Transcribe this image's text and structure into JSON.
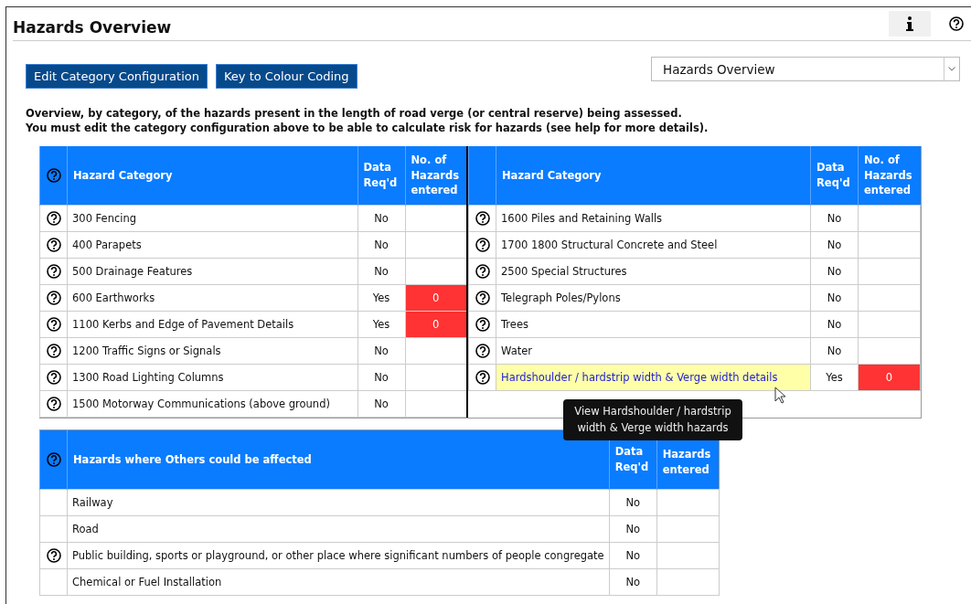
{
  "header": {
    "title": "Hazards Overview"
  },
  "buttons": [
    {
      "label": "Edit Category Configuration"
    },
    {
      "label": "Key to Colour Coding"
    }
  ],
  "view_select": {
    "value": "Hazards Overview"
  },
  "intro": [
    "Overview, by category, of the hazards present in the length of road verge (or central reserve) being assessed.",
    "You must edit the category configuration above to be able to calculate risk for hazards (see help for more details)."
  ],
  "category_tables": [
    {
      "help": true,
      "columns": [
        "Hazard Category",
        "Data Req'd",
        "No. of Hazards entered"
      ],
      "rows": [
        {
          "help": true,
          "kind": "text",
          "hovered": false,
          "category": "300 Fencing",
          "data_reqd": "No",
          "flagged": false
        },
        {
          "help": true,
          "kind": "text",
          "hovered": false,
          "category": "400 Parapets",
          "data_reqd": "No",
          "flagged": false
        },
        {
          "help": true,
          "kind": "text",
          "hovered": false,
          "category": "500 Drainage Features",
          "data_reqd": "No",
          "flagged": false
        },
        {
          "help": true,
          "kind": "text",
          "hovered": false,
          "category": "600 Earthworks",
          "data_reqd": "Yes",
          "count": "0",
          "flagged": true
        },
        {
          "help": true,
          "kind": "text",
          "hovered": false,
          "category": "1100 Kerbs and Edge of Pavement Details",
          "data_reqd": "Yes",
          "count": "0",
          "flagged": true
        },
        {
          "help": true,
          "kind": "text",
          "hovered": false,
          "category": "1200 Traffic Signs or Signals",
          "data_reqd": "No",
          "flagged": false
        },
        {
          "help": true,
          "kind": "text",
          "hovered": false,
          "category": "1300 Road Lighting Columns",
          "data_reqd": "No",
          "flagged": false
        },
        {
          "help": true,
          "kind": "text",
          "hovered": false,
          "category": "1500 Motorway Communications (above ground)",
          "data_reqd": "No",
          "flagged": false
        }
      ]
    },
    {
      "help": false,
      "columns": [
        "Hazard Category",
        "Data Req'd",
        "No. of Hazards entered"
      ],
      "rows": [
        {
          "help": true,
          "kind": "text",
          "hovered": false,
          "category": "1600 Piles and Retaining Walls",
          "data_reqd": "No",
          "flagged": false
        },
        {
          "help": true,
          "kind": "text",
          "hovered": false,
          "category": "1700 1800 Structural Concrete and Steel",
          "data_reqd": "No",
          "flagged": false
        },
        {
          "help": true,
          "kind": "text",
          "hovered": false,
          "category": "2500 Special Structures",
          "data_reqd": "No",
          "flagged": false
        },
        {
          "help": true,
          "kind": "text",
          "hovered": false,
          "category": "Telegraph Poles/Pylons",
          "data_reqd": "No",
          "flagged": false
        },
        {
          "help": true,
          "kind": "text",
          "hovered": false,
          "category": "Trees",
          "data_reqd": "No",
          "flagged": false
        },
        {
          "help": true,
          "kind": "text",
          "hovered": false,
          "category": "Water",
          "data_reqd": "No",
          "flagged": false
        },
        {
          "help": true,
          "kind": "link",
          "hovered": true,
          "category": "Hardshoulder / hardstrip width & Verge width details",
          "data_reqd": "Yes",
          "count": "0",
          "flagged": true
        }
      ]
    }
  ],
  "others_table": {
    "help": true,
    "columns": [
      "Hazards where Others could be affected",
      "Data Req'd",
      "Hazards entered"
    ],
    "rows": [
      {
        "help": false,
        "category": "Railway",
        "data_reqd": "No",
        "flagged": false
      },
      {
        "help": false,
        "category": "Road",
        "data_reqd": "No",
        "flagged": false
      },
      {
        "help": true,
        "category": "Public building, sports or playground, or other place where significant numbers of people congregate",
        "data_reqd": "No",
        "flagged": false
      },
      {
        "help": false,
        "category": "Chemical or Fuel Installation",
        "data_reqd": "No",
        "flagged": false
      }
    ]
  },
  "tooltip": {
    "text": "View Hardshoulder / hardstrip width & Verge width hazards"
  }
}
